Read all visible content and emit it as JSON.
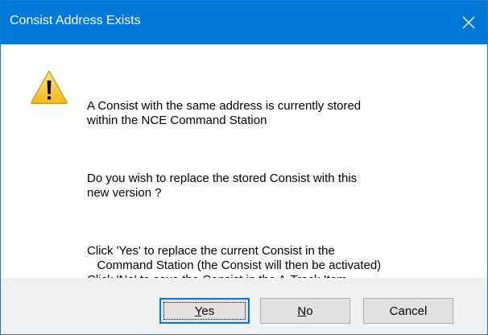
{
  "window": {
    "title": "Consist Address Exists",
    "close_icon": "close-icon"
  },
  "icon": "warning-icon",
  "message": {
    "paragraph1": "A Consist with the same address is currently stored\nwithin the NCE Command Station",
    "paragraph2": "Do you wish to replace the stored Consist with this\nnew version ?",
    "paragraph3": "Click 'Yes' to replace the current Consist in the\n   Command Station (the Consist will then be activated)\nClick 'No' to save the Consist in the A-Track Item\n   List only (the Consist will not be activated)\nClick 'Cancel' to return to CV Edit"
  },
  "buttons": {
    "yes": {
      "mnemonic": "Y",
      "rest": "es"
    },
    "no": {
      "mnemonic": "N",
      "rest": "o"
    },
    "cancel": "Cancel"
  },
  "colors": {
    "titlebar": "#0078d7",
    "default_button_border": "#0078d7",
    "button_face": "#e1e1e1",
    "footer": "#f0f0f0"
  }
}
